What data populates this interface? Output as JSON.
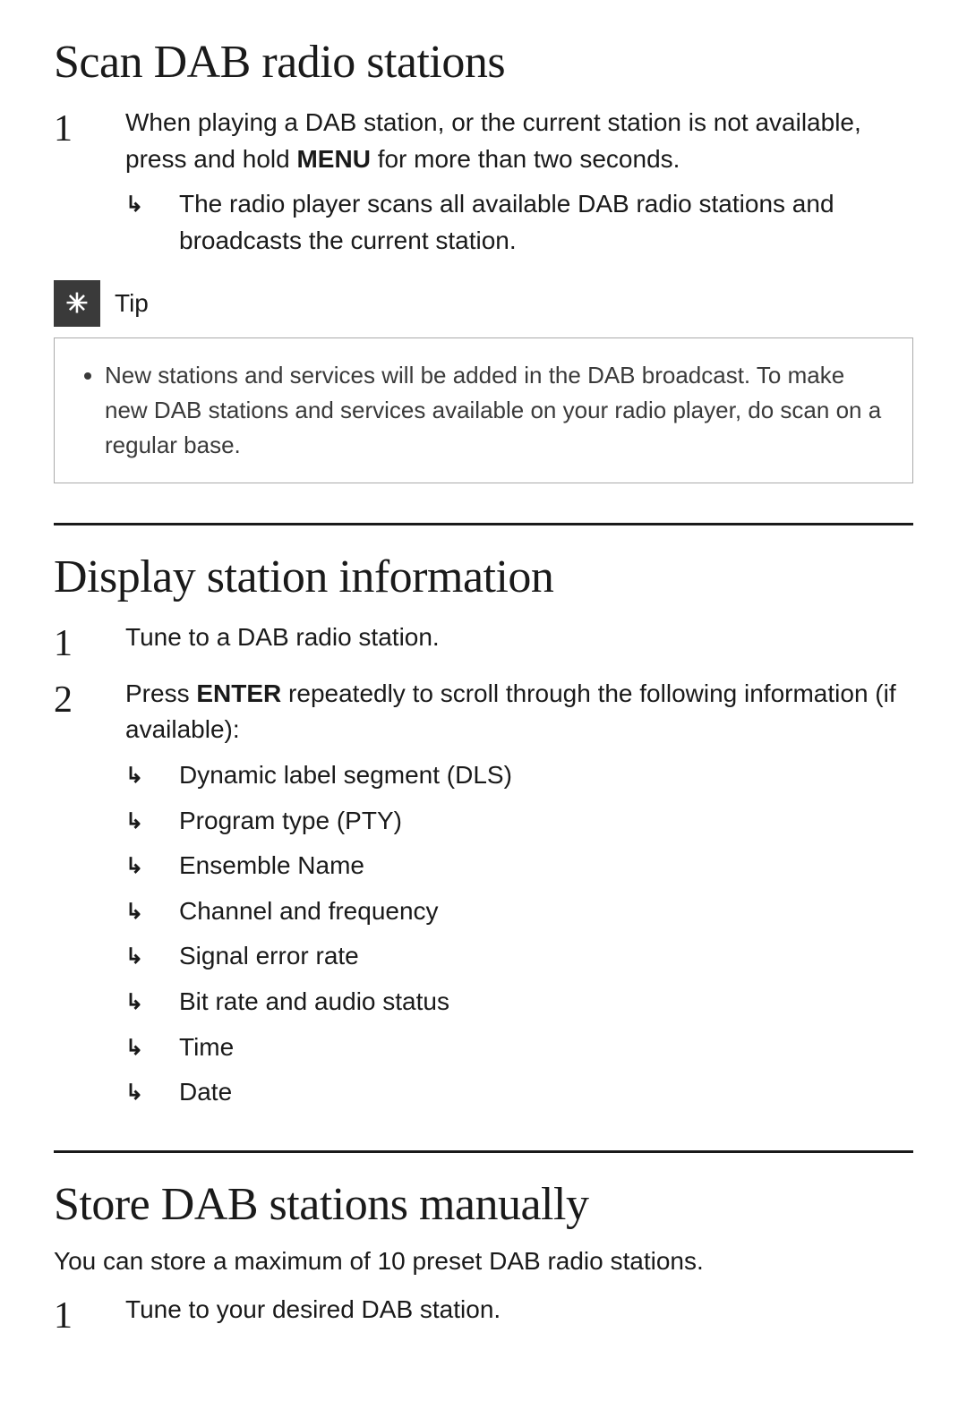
{
  "scan_section": {
    "title": "Scan DAB radio stations",
    "step1": {
      "number": "1",
      "text_before_keyword": "When playing a DAB station, or the current station is not available, press and hold ",
      "keyword": "MENU",
      "text_after_keyword": " for more than two seconds.",
      "arrow_text": "The radio player scans all available DAB radio stations and broadcasts the current station."
    }
  },
  "tip": {
    "icon": "✳",
    "label": "Tip",
    "bullet": "New stations and services will be added in the DAB broadcast. To make new DAB stations and services available on your radio player, do scan on a regular base."
  },
  "display_section": {
    "title": "Display station information",
    "step1": {
      "number": "1",
      "text": "Tune to a DAB radio station."
    },
    "step2": {
      "number": "2",
      "text_before_keyword": "Press ",
      "keyword": "ENTER",
      "text_after_keyword": " repeatedly to scroll through the following information (if available):",
      "arrows": [
        "Dynamic label segment (DLS)",
        "Program type (PTY)",
        "Ensemble Name",
        "Channel and frequency",
        "Signal error rate",
        "Bit rate and audio status",
        "Time",
        "Date"
      ]
    }
  },
  "store_section": {
    "title": "Store DAB stations manually",
    "intro": "You can store a maximum of 10 preset DAB radio stations.",
    "step1": {
      "number": "1",
      "text": "Tune to your desired DAB station."
    }
  }
}
